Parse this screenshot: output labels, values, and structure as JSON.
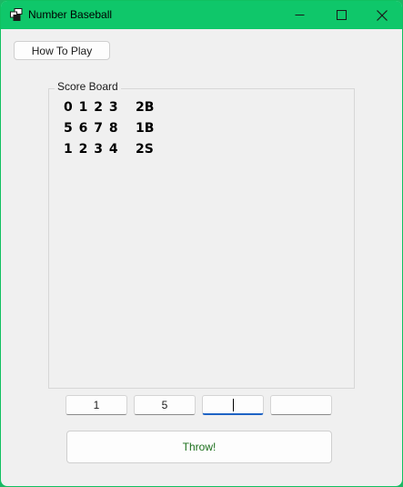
{
  "window": {
    "title": "Number Baseball",
    "accent_color": "#0fc76a"
  },
  "toolbar": {
    "how_to_play_label": "How To Play"
  },
  "scoreboard": {
    "title": "Score Board",
    "rows": [
      {
        "guess": "0 1 2 3",
        "result": "2B"
      },
      {
        "guess": "5 6 7 8",
        "result": "1B"
      },
      {
        "guess": "1 2 3 4",
        "result": "2S"
      }
    ]
  },
  "inputs": {
    "digits": [
      "1",
      "5",
      "",
      ""
    ],
    "active_index": 2
  },
  "actions": {
    "throw_label": "Throw!",
    "throw_text_color": "#1a6e1a"
  }
}
